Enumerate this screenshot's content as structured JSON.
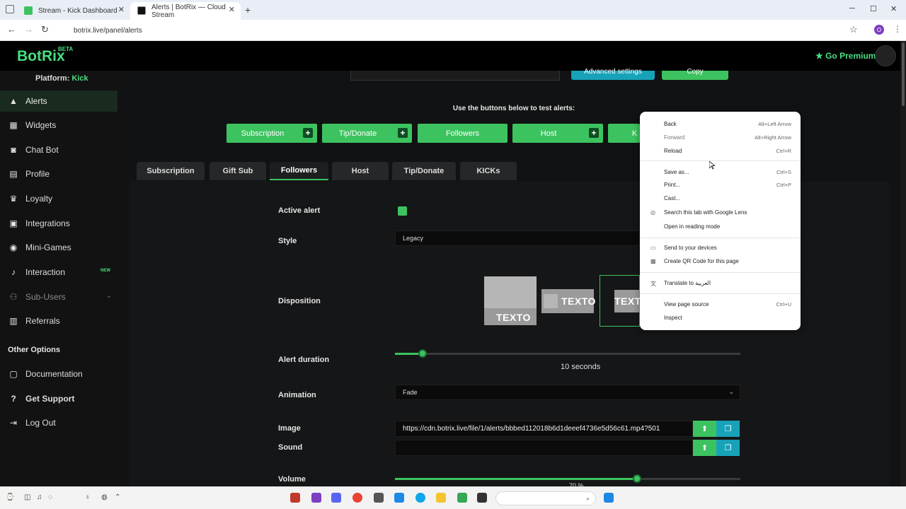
{
  "browser": {
    "tabs": [
      {
        "title": "Stream - Kick Dashboard",
        "active": false
      },
      {
        "title": "Alerts | BotRix — Cloud Stream",
        "active": true
      }
    ],
    "url": "botrix.live/panel/alerts",
    "profile_initial": "O"
  },
  "app": {
    "logo": "BotRix",
    "logo_badge": "BETA",
    "premium_label": "Go Premium"
  },
  "sidebar": {
    "platform_label": "Platform:",
    "platform_value": "Kick",
    "items": [
      {
        "label": "Alerts",
        "icon": "warning-icon"
      },
      {
        "label": "Widgets",
        "icon": "grid-icon"
      },
      {
        "label": "Chat Bot",
        "icon": "robot-icon"
      },
      {
        "label": "Profile",
        "icon": "id-card-icon"
      },
      {
        "label": "Loyalty",
        "icon": "trophy-icon"
      },
      {
        "label": "Integrations",
        "icon": "plug-icon"
      },
      {
        "label": "Mini-Games",
        "icon": "gamepad-icon"
      },
      {
        "label": "Interaction",
        "icon": "music-icon",
        "badge": "NEW"
      },
      {
        "label": "Sub-Users",
        "icon": "users-icon"
      },
      {
        "label": "Referrals",
        "icon": "referral-icon"
      }
    ],
    "other_section": "Other Options",
    "other_items": [
      {
        "label": "Documentation",
        "icon": "book-icon"
      },
      {
        "label": "Get Support",
        "icon": "help-icon"
      },
      {
        "label": "Log Out",
        "icon": "logout-icon"
      }
    ]
  },
  "main": {
    "top_buttons": {
      "advanced": "Advanced settings",
      "copy": "Copy"
    },
    "test_title": "Use the buttons below to test alerts:",
    "test_buttons": [
      "Subscription",
      "Tip/Donate",
      "Followers",
      "Host",
      "K"
    ],
    "tabs": [
      "Subscription",
      "Gift Sub",
      "Followers",
      "Host",
      "Tip/Donate",
      "KICKs"
    ],
    "active_tab": "Followers",
    "form": {
      "active_alert_label": "Active alert",
      "style_label": "Style",
      "style_value": "Legacy",
      "disposition_label": "Disposition",
      "disposition_text": "TEXTO",
      "duration_label": "Alert duration",
      "duration_value": "10",
      "duration_unit": "seconds",
      "duration_fraction": 0.08,
      "animation_label": "Animation",
      "animation_value": "Fade",
      "image_label": "Image",
      "image_value": "https://cdn.botrix.live/file/1/alerts/bbbed112018b6d1deeef4736e5d56c61.mp4?501",
      "sound_label": "Sound",
      "sound_value": "",
      "volume_label": "Volume",
      "volume_value": "70 %",
      "volume_fraction": 0.7
    }
  },
  "context_menu": {
    "items": [
      {
        "label": "Back",
        "shortcut": "Alt+Left Arrow",
        "disabled": false
      },
      {
        "label": "Forward",
        "shortcut": "Alt+Right Arrow",
        "disabled": true
      },
      {
        "label": "Reload",
        "shortcut": "Ctrl+R",
        "disabled": false
      },
      {
        "label": "Save as...",
        "shortcut": "Ctrl+S",
        "disabled": false
      },
      {
        "label": "Print...",
        "shortcut": "Ctrl+P",
        "disabled": false
      },
      {
        "label": "Cast...",
        "shortcut": "",
        "disabled": false
      },
      {
        "label": "Search this tab with Google Lens",
        "shortcut": "",
        "disabled": false
      },
      {
        "label": "Open in reading mode",
        "shortcut": "",
        "disabled": false
      },
      {
        "label": "Send to your devices",
        "shortcut": "",
        "disabled": false
      },
      {
        "label": "Create QR Code for this page",
        "shortcut": "",
        "disabled": false
      },
      {
        "label": "Translate to العربية",
        "shortcut": "",
        "disabled": false
      },
      {
        "label": "View page source",
        "shortcut": "Ctrl+U",
        "disabled": false
      },
      {
        "label": "Inspect",
        "shortcut": "",
        "disabled": false
      }
    ]
  },
  "colors": {
    "accent": "#3cc35f",
    "accent_text": "#4ade80",
    "info": "#17a2b8",
    "background": "#111213"
  }
}
